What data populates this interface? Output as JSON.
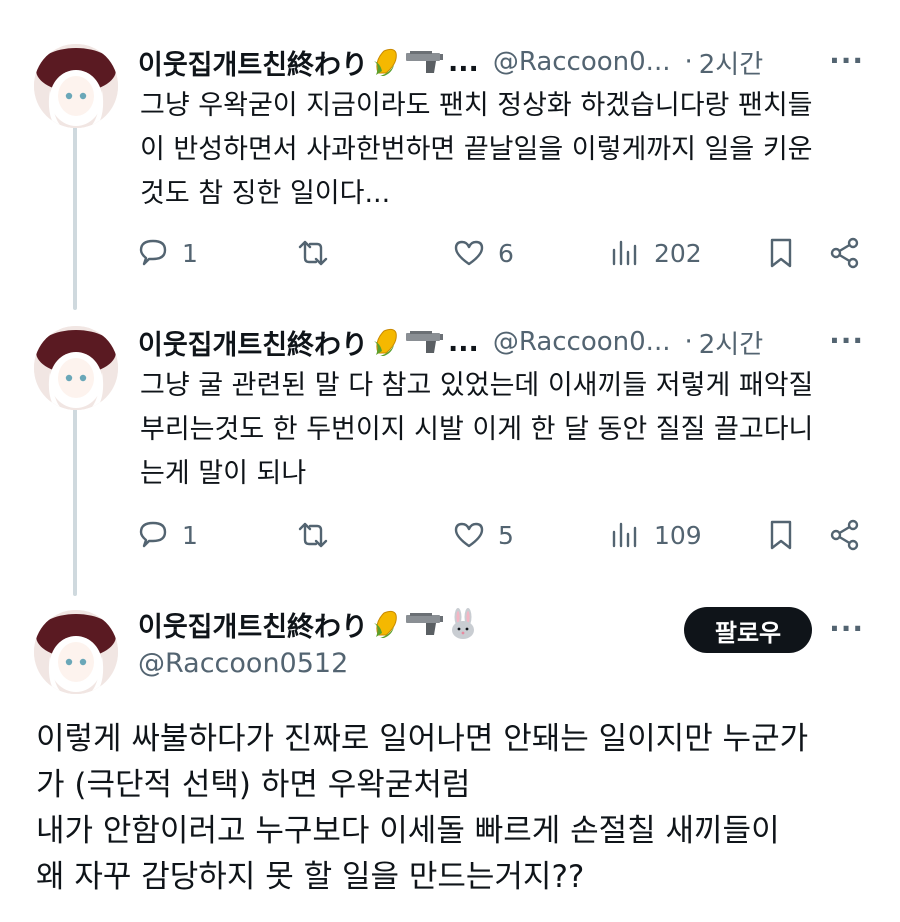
{
  "author": {
    "name": "이웃집개트친終わり",
    "handle_truncated": "@Raccoon0...",
    "handle_full": "@Raccoon0512",
    "emojis": [
      "corn",
      "pistol"
    ],
    "emojis_main": [
      "corn",
      "pistol",
      "rabbit"
    ]
  },
  "replies": [
    {
      "time": "2시간",
      "text": "그냥 우왁굳이 지금이라도 팬치 정상화 하겠습니다랑 팬치들이 반성하면서 사과한번하면 끝날일을 이렇게까지 일을 키운것도 참 징한 일이다...",
      "lines": [
        "그냥 우왁굳이 지금이라도 팬치 정상화 하겠습니다랑 팬치들",
        "이 반성하면서 사과한번하면 끝날일을 이렇게까지 일을 키운",
        "것도 참 징한 일이다..."
      ],
      "replies": "1",
      "reposts": "",
      "likes": "6",
      "views": "202"
    },
    {
      "time": "2시간",
      "text": "그냥 굴 관련된 말 다 참고 있었는데 이새끼들 저렇게 패악질 부리는것도 한 두번이지 시발 이게 한 달 동안 질질 끌고다니는게 말이 되나",
      "lines": [
        "그냥 굴 관련된 말 다 참고 있었는데 이새끼들 저렇게 패악질",
        "부리는것도 한 두번이지 시발 이게 한 달 동안 질질 끌고다니",
        "는게 말이 되나"
      ],
      "replies": "1",
      "reposts": "",
      "likes": "5",
      "views": "109"
    }
  ],
  "main_tweet": {
    "follow_label": "팔로우",
    "lines": [
      "이렇게 싸불하다가 진짜로 일어나면 안돼는 일이지만 누군가",
      "가 (극단적 선택) 하면 우왁굳처럼",
      "내가 안함이러고 누구보다 이세돌 빠르게 손절칠 새끼들이",
      "왜 자꾸 감당하지 못 할 일을 만드는거지??"
    ]
  },
  "ui": {
    "dot": "·",
    "more": "···",
    "ellipsis": "..."
  },
  "colors": {
    "text": "#0f1419",
    "secondary": "#536471",
    "thread_line": "#cfd9de",
    "follow_bg": "#0f1419"
  }
}
